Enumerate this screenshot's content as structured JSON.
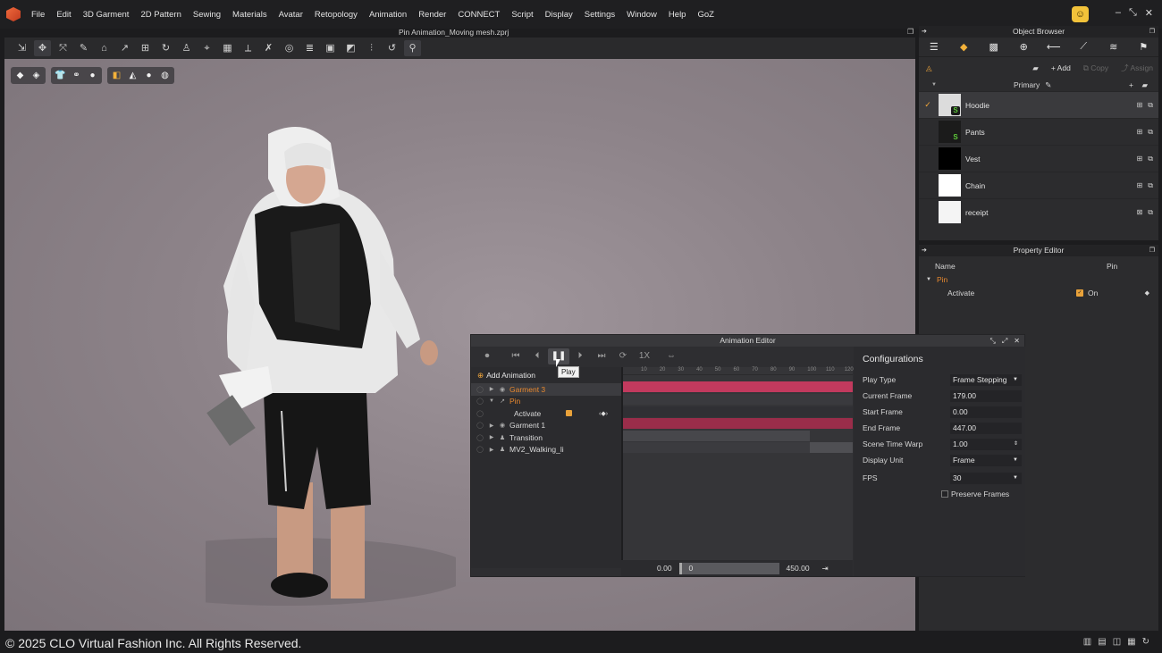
{
  "menubar": {
    "items": [
      "File",
      "Edit",
      "3D Garment",
      "2D Pattern",
      "Sewing",
      "Materials",
      "Avatar",
      "Retopology",
      "Animation",
      "Render",
      "CONNECT",
      "Script",
      "Display",
      "Settings",
      "Window",
      "Help",
      "GoZ"
    ]
  },
  "document": {
    "title": "Pin Animation_Moving mesh.zprj"
  },
  "footer": {
    "copyright": "© 2025 CLO Virtual Fashion Inc. All Rights Reserved."
  },
  "object_browser": {
    "title": "Object Browser",
    "add_label": "Add",
    "copy_label": "Copy",
    "assign_label": "Assign",
    "group_label": "Primary",
    "items": [
      {
        "name": "Hoodie",
        "checked": true,
        "thumb": "#dcdcdc"
      },
      {
        "name": "Pants",
        "checked": false,
        "thumb": "#1b1b1b"
      },
      {
        "name": "Vest",
        "checked": false,
        "thumb": "#000000"
      },
      {
        "name": "Chain",
        "checked": false,
        "thumb": "#ffffff"
      },
      {
        "name": "receipt",
        "checked": false,
        "thumb": "#f4f4f4"
      }
    ]
  },
  "property_editor": {
    "title": "Property Editor",
    "name_label": "Name",
    "name_value": "Pin",
    "section": "Pin",
    "activate_label": "Activate",
    "activate_value": "On"
  },
  "animation_editor": {
    "title": "Animation Editor",
    "speed_label": "1X",
    "tooltip": "Play",
    "add_animation": "Add Animation",
    "tracks": [
      {
        "label": "Garment 3",
        "level": 0,
        "style": "highlight"
      },
      {
        "label": "Pin",
        "level": 0,
        "style": "orange"
      },
      {
        "label": "Activate",
        "level": 1,
        "style": "normal"
      },
      {
        "label": "Garment 1",
        "level": 0,
        "style": "normal"
      },
      {
        "label": "Transition",
        "level": 0,
        "style": "normal"
      },
      {
        "label": "MV2_Walking_li",
        "level": 0,
        "style": "normal"
      }
    ],
    "ruler_ticks": [
      "10",
      "20",
      "30",
      "40",
      "50",
      "60",
      "70",
      "80",
      "90",
      "100",
      "110",
      "120"
    ],
    "time_start": "0.00",
    "time_current": "0",
    "time_end": "450.00",
    "config": {
      "title": "Configurations",
      "rows": [
        {
          "label": "Play Type",
          "value": "Frame Stepping",
          "type": "dropdown"
        },
        {
          "label": "Current Frame",
          "value": "179.00",
          "type": "field"
        },
        {
          "label": "Start Frame",
          "value": "0.00",
          "type": "field"
        },
        {
          "label": "End Frame",
          "value": "447.00",
          "type": "field"
        },
        {
          "label": "Scene Time Warp",
          "value": "1.00",
          "type": "spinner"
        },
        {
          "label": "Display Unit",
          "value": "Frame",
          "type": "dropdown"
        },
        {
          "label": "FPS",
          "value": "30",
          "type": "dropdown"
        }
      ],
      "preserve_frames": "Preserve Frames"
    }
  }
}
